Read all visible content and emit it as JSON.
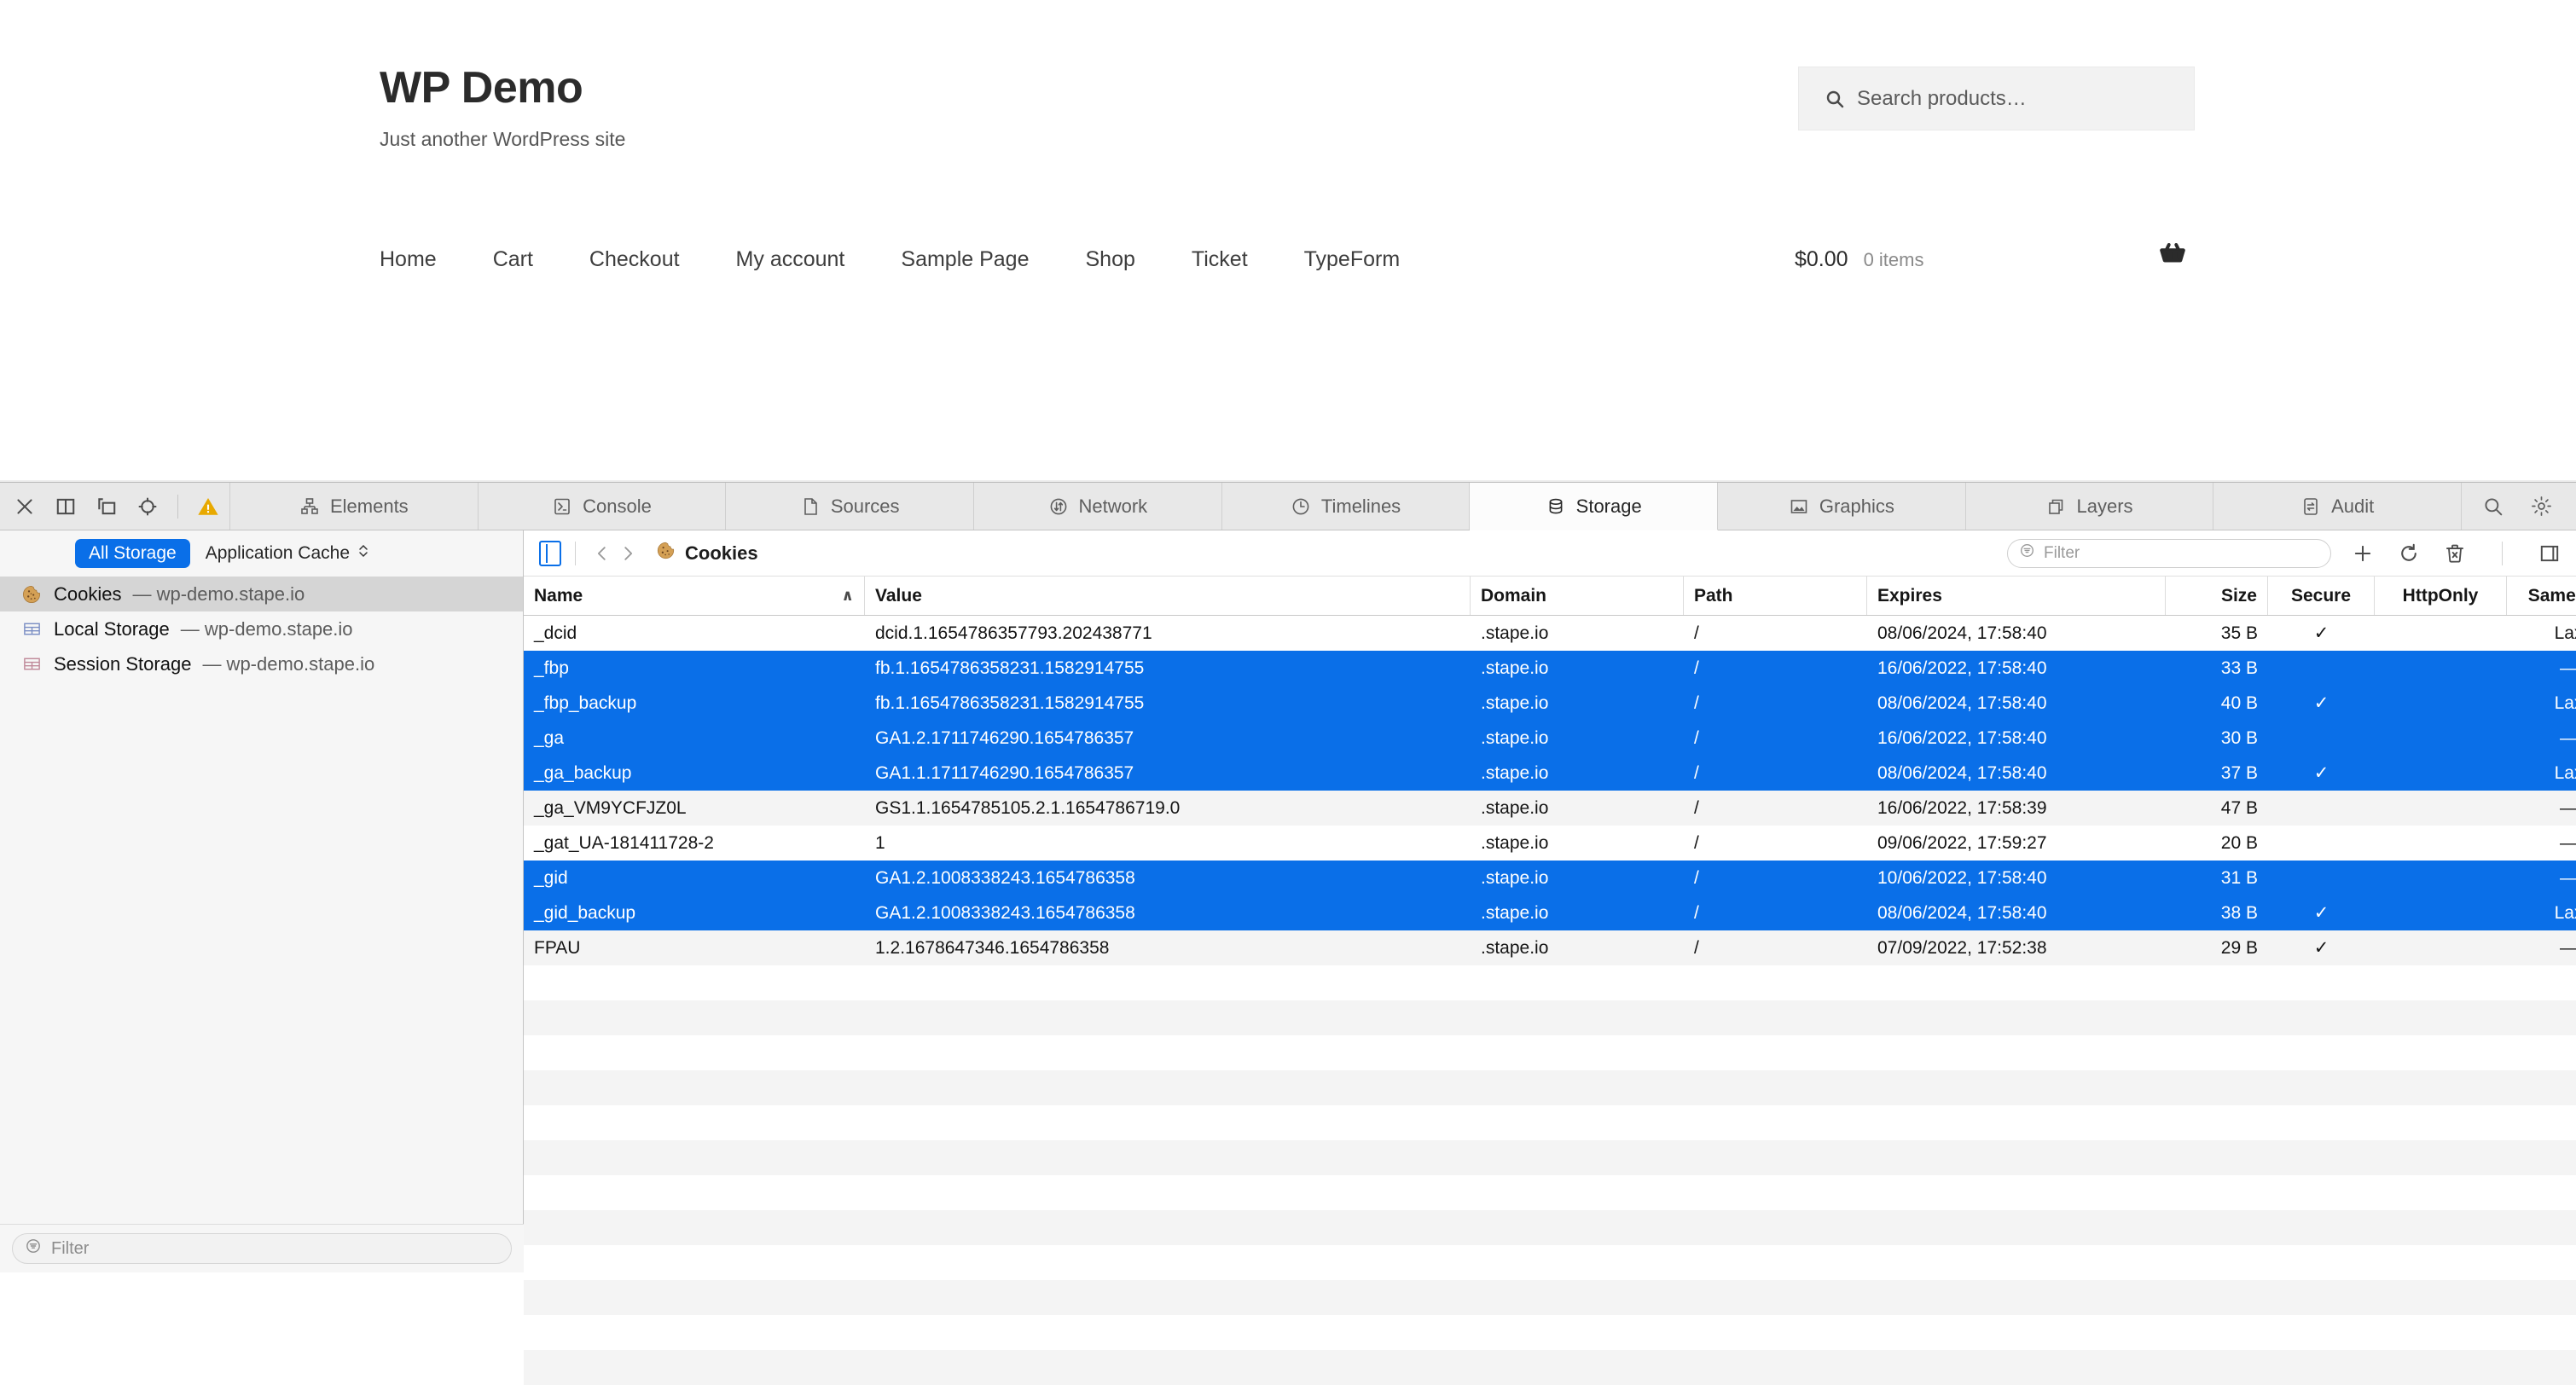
{
  "site": {
    "title": "WP Demo",
    "tagline": "Just another WordPress site",
    "search_placeholder": "Search products…",
    "nav": [
      {
        "label": "Home"
      },
      {
        "label": "Cart"
      },
      {
        "label": "Checkout"
      },
      {
        "label": "My account"
      },
      {
        "label": "Sample Page"
      },
      {
        "label": "Shop"
      },
      {
        "label": "Ticket"
      },
      {
        "label": "TypeForm"
      }
    ],
    "cart": {
      "amount": "$0.00",
      "count": "0 items",
      "icon": "basket-icon"
    }
  },
  "inspector": {
    "toolbar_icons": [
      {
        "name": "close-icon"
      },
      {
        "name": "dock-right-icon"
      },
      {
        "name": "dock-bottom-icon"
      },
      {
        "name": "inspect-element-icon"
      },
      {
        "name": "warning-icon"
      }
    ],
    "tabs": [
      {
        "label": "Elements",
        "icon": "elements-icon",
        "active": false
      },
      {
        "label": "Console",
        "icon": "console-icon",
        "active": false
      },
      {
        "label": "Sources",
        "icon": "sources-icon",
        "active": false
      },
      {
        "label": "Network",
        "icon": "network-icon",
        "active": false
      },
      {
        "label": "Timelines",
        "icon": "timelines-icon",
        "active": false
      },
      {
        "label": "Storage",
        "icon": "storage-icon",
        "active": true
      },
      {
        "label": "Graphics",
        "icon": "graphics-icon",
        "active": false
      },
      {
        "label": "Layers",
        "icon": "layers-icon",
        "active": false
      },
      {
        "label": "Audit",
        "icon": "audit-icon",
        "active": false
      }
    ],
    "toolbar_right_icons": [
      {
        "name": "search-icon"
      },
      {
        "name": "settings-gear-icon"
      }
    ],
    "sidebar": {
      "scope_pill": "All Storage",
      "scope_select": "Application Cache",
      "items": [
        {
          "label": "Cookies",
          "detail": "— wp-demo.stape.io",
          "icon": "cookie-icon",
          "selected": true
        },
        {
          "label": "Local Storage",
          "detail": "— wp-demo.stape.io",
          "icon": "table-blue-icon",
          "selected": false
        },
        {
          "label": "Session Storage",
          "detail": "— wp-demo.stape.io",
          "icon": "table-pink-icon",
          "selected": false
        }
      ],
      "filter_placeholder": "Filter"
    },
    "navbar": {
      "breadcrumb": "Cookies",
      "breadcrumb_icon": "cookie-icon",
      "filter_placeholder": "Filter",
      "actions": [
        {
          "name": "add-cookie-icon"
        },
        {
          "name": "refresh-icon"
        },
        {
          "name": "clear-cookies-icon"
        },
        {
          "name": "toggle-details-sidebar-icon"
        }
      ]
    },
    "grid": {
      "columns": [
        {
          "key": "name",
          "label": "Name",
          "sorted": true,
          "sort_dir": "∧"
        },
        {
          "key": "value",
          "label": "Value",
          "sorted": false
        },
        {
          "key": "domain",
          "label": "Domain",
          "sorted": false
        },
        {
          "key": "path",
          "label": "Path",
          "sorted": false
        },
        {
          "key": "expires",
          "label": "Expires",
          "sorted": false
        },
        {
          "key": "size",
          "label": "Size",
          "sorted": false
        },
        {
          "key": "secure",
          "label": "Secure",
          "sorted": false
        },
        {
          "key": "httponly",
          "label": "HttpOnly",
          "sorted": false
        },
        {
          "key": "samesite",
          "label": "SameSite",
          "sorted": false
        }
      ],
      "rows": [
        {
          "name": "_dcid",
          "value": "dcid.1.1654786357793.202438771",
          "domain": ".stape.io",
          "path": "/",
          "expires": "08/06/2024, 17:58:40",
          "size": "35 B",
          "secure": "✓",
          "httponly": "",
          "samesite": "Lax",
          "selected": false
        },
        {
          "name": "_fbp",
          "value": "fb.1.1654786358231.1582914755",
          "domain": ".stape.io",
          "path": "/",
          "expires": "16/06/2022, 17:58:40",
          "size": "33 B",
          "secure": "",
          "httponly": "",
          "samesite": "—",
          "selected": true
        },
        {
          "name": "_fbp_backup",
          "value": "fb.1.1654786358231.1582914755",
          "domain": ".stape.io",
          "path": "/",
          "expires": "08/06/2024, 17:58:40",
          "size": "40 B",
          "secure": "✓",
          "httponly": "",
          "samesite": "Lax",
          "selected": true
        },
        {
          "name": "_ga",
          "value": "GA1.2.1711746290.1654786357",
          "domain": ".stape.io",
          "path": "/",
          "expires": "16/06/2022, 17:58:40",
          "size": "30 B",
          "secure": "",
          "httponly": "",
          "samesite": "—",
          "selected": true
        },
        {
          "name": "_ga_backup",
          "value": "GA1.1.1711746290.1654786357",
          "domain": ".stape.io",
          "path": "/",
          "expires": "08/06/2024, 17:58:40",
          "size": "37 B",
          "secure": "✓",
          "httponly": "",
          "samesite": "Lax",
          "selected": true
        },
        {
          "name": "_ga_VM9YCFJZ0L",
          "value": "GS1.1.1654785105.2.1.1654786719.0",
          "domain": ".stape.io",
          "path": "/",
          "expires": "16/06/2022, 17:58:39",
          "size": "47 B",
          "secure": "",
          "httponly": "",
          "samesite": "—",
          "selected": false
        },
        {
          "name": "_gat_UA-181411728-2",
          "value": "1",
          "domain": ".stape.io",
          "path": "/",
          "expires": "09/06/2022, 17:59:27",
          "size": "20 B",
          "secure": "",
          "httponly": "",
          "samesite": "—",
          "selected": false
        },
        {
          "name": "_gid",
          "value": "GA1.2.1008338243.1654786358",
          "domain": ".stape.io",
          "path": "/",
          "expires": "10/06/2022, 17:58:40",
          "size": "31 B",
          "secure": "",
          "httponly": "",
          "samesite": "—",
          "selected": true
        },
        {
          "name": "_gid_backup",
          "value": "GA1.2.1008338243.1654786358",
          "domain": ".stape.io",
          "path": "/",
          "expires": "08/06/2024, 17:58:40",
          "size": "38 B",
          "secure": "✓",
          "httponly": "",
          "samesite": "Lax",
          "selected": true
        },
        {
          "name": "FPAU",
          "value": "1.2.1678647346.1654786358",
          "domain": ".stape.io",
          "path": "/",
          "expires": "07/09/2022, 17:52:38",
          "size": "29 B",
          "secure": "✓",
          "httponly": "",
          "samesite": "—",
          "selected": false
        }
      ]
    }
  },
  "colors": {
    "selection_blue": "#0a6fe8",
    "stripe": "#f4f4f4",
    "tabbar_bg": "#e8e8e8",
    "sidebar_bg": "#f6f6f6",
    "warning_amber": "#e8a900"
  }
}
